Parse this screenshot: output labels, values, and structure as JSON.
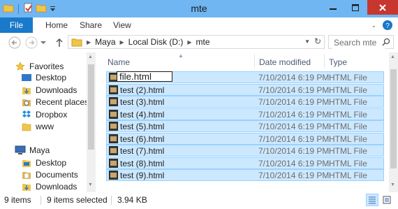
{
  "window": {
    "title": "mte"
  },
  "ribbon": {
    "file_tab": "File",
    "tabs": [
      "Home",
      "Share",
      "View"
    ]
  },
  "address": {
    "crumbs": [
      "Maya",
      "Local Disk (D:)",
      "mte"
    ],
    "search_placeholder": "Search mte"
  },
  "nav_pane": {
    "items": [
      {
        "label": "Favorites",
        "icon": "star-icon",
        "icon_color": "#f5c342"
      },
      {
        "label": "Desktop",
        "icon": "desktop-icon",
        "icon_color": "#2f78c6"
      },
      {
        "label": "Downloads",
        "icon": "downloads-icon",
        "icon_color": "#2f78c6"
      },
      {
        "label": "Recent places",
        "icon": "recent-places-icon",
        "icon_color": "#e8b64c"
      },
      {
        "label": "Dropbox",
        "icon": "dropbox-icon",
        "icon_color": "#1f8fe0"
      },
      {
        "label": "www",
        "icon": "folder-icon",
        "icon_color": "#f0c64a"
      },
      {
        "label": "Maya",
        "icon": "computer-icon",
        "icon_color": "#3b6db5"
      },
      {
        "label": "Desktop",
        "icon": "desktop-icon",
        "icon_color": "#2f78c6"
      },
      {
        "label": "Documents",
        "icon": "documents-icon",
        "icon_color": "#e8b64c"
      },
      {
        "label": "Downloads",
        "icon": "downloads-icon",
        "icon_color": "#2f78c6"
      }
    ]
  },
  "file_list": {
    "columns": {
      "name": "Name",
      "date": "Date modified",
      "type": "Type"
    },
    "rename_value": "file.html",
    "files": [
      {
        "name": "file.html",
        "date": "7/10/2014 6:19 PM",
        "type": "HTML File"
      },
      {
        "name": "test (2).html",
        "date": "7/10/2014 6:19 PM",
        "type": "HTML File"
      },
      {
        "name": "test (3).html",
        "date": "7/10/2014 6:19 PM",
        "type": "HTML File"
      },
      {
        "name": "test (4).html",
        "date": "7/10/2014 6:19 PM",
        "type": "HTML File"
      },
      {
        "name": "test (5).html",
        "date": "7/10/2014 6:19 PM",
        "type": "HTML File"
      },
      {
        "name": "test (6).html",
        "date": "7/10/2014 6:19 PM",
        "type": "HTML File"
      },
      {
        "name": "test (7).html",
        "date": "7/10/2014 6:19 PM",
        "type": "HTML File"
      },
      {
        "name": "test (8).html",
        "date": "7/10/2014 6:19 PM",
        "type": "HTML File"
      },
      {
        "name": "test (9).html",
        "date": "7/10/2014 6:19 PM",
        "type": "HTML File"
      }
    ]
  },
  "status": {
    "item_count": "9 items",
    "selected": "9 items selected",
    "size": "3.94 KB"
  },
  "colors": {
    "title_bar": "#6fb6f3",
    "file_tab": "#1979ca",
    "close_button": "#c7372f",
    "selection_fill": "#cce8ff",
    "selection_border": "#99d1ff"
  }
}
